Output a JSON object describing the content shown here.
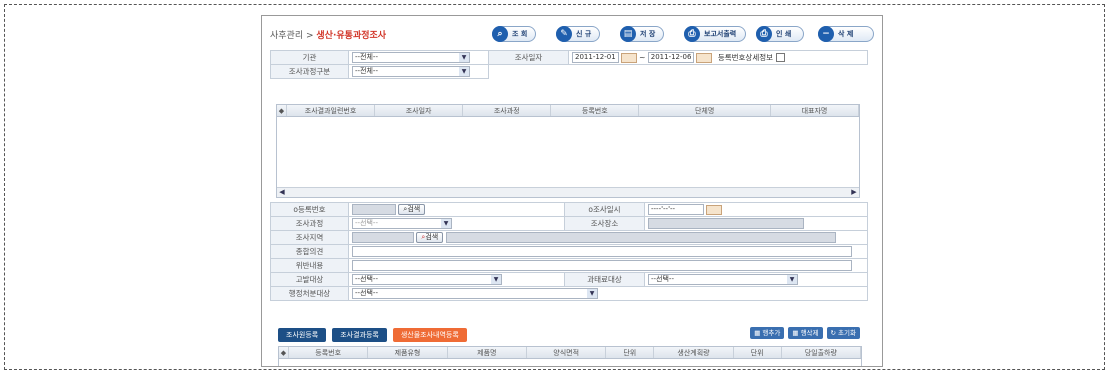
{
  "breadcrumb": {
    "parent": "사후관리 >",
    "current": "생산·유통과정조사"
  },
  "toolbar": [
    {
      "label": "조 회",
      "icon": "⌕"
    },
    {
      "label": "신 규",
      "icon": "✎"
    },
    {
      "label": "저 장",
      "icon": "▤"
    },
    {
      "label": "보고서출력",
      "icon": "⎙"
    },
    {
      "label": "인 쇄",
      "icon": "⎙"
    },
    {
      "label": "삭 제",
      "icon": "−"
    }
  ],
  "search": {
    "org_label": "기관",
    "org_value": "--전체--",
    "date_label": "조사일자",
    "date_from": "2011-12-01",
    "date_to": "2011-12-06",
    "detail_label": "등록번호상세정보",
    "type_label": "조사과정구분",
    "type_value": "--전체--"
  },
  "grid": {
    "columns": [
      "조사결과일련번호",
      "조사일자",
      "조사과정",
      "등록번호",
      "단체명",
      "대표자명"
    ]
  },
  "detail": {
    "reg_no_label": "o등록번호",
    "search_btn": "검색",
    "survey_date_label": "o조사일시",
    "survey_date_value": "----'--'--",
    "process_label": "조사과정",
    "process_value": "--선택--",
    "place_label": "조사장소",
    "area_label": "조사지역",
    "area_btn": "검색",
    "opinion_label": "종합의견",
    "violation_label": "위반내용",
    "accuse_label": "고발대상",
    "accuse_value": "--선택--",
    "fine_label": "과태료대상",
    "fine_value": "--선택--",
    "admin_label": "행정처분대상",
    "admin_value": "--선택--"
  },
  "tabs": [
    "조사원등록",
    "조사결과등록",
    "생산물조사내역등록"
  ],
  "row_buttons": [
    "행추가",
    "행삭제",
    "초기화"
  ],
  "grid2": {
    "columns": [
      "등록번호",
      "제품유형",
      "제품명",
      "양식면적",
      "단위",
      "생산계획량",
      "단위",
      "당일출하량"
    ]
  }
}
